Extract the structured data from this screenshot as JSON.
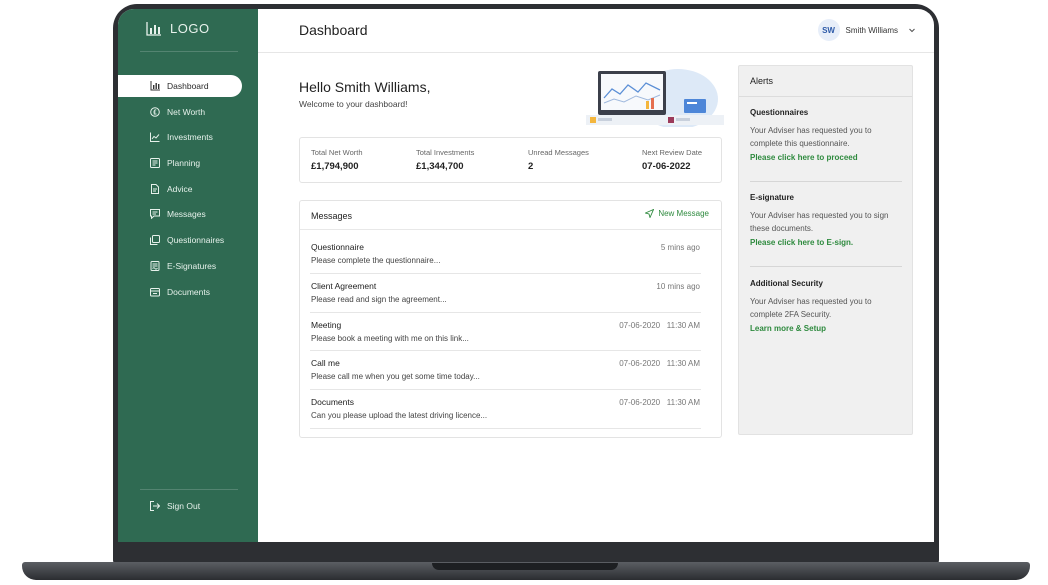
{
  "sidebar": {
    "logo_text": "LOGO",
    "items": [
      {
        "label": "Dashboard",
        "icon": "bar-chart-icon"
      },
      {
        "label": "Net Worth",
        "icon": "pound-coin-icon"
      },
      {
        "label": "Investments",
        "icon": "trend-chart-icon"
      },
      {
        "label": "Planning",
        "icon": "planning-icon"
      },
      {
        "label": "Advice",
        "icon": "document-icon"
      },
      {
        "label": "Messages",
        "icon": "message-icon"
      },
      {
        "label": "Questionnaires",
        "icon": "questionnaire-icon"
      },
      {
        "label": "E-Signatures",
        "icon": "signature-icon"
      },
      {
        "label": "Documents",
        "icon": "folder-icon"
      }
    ],
    "active_item": "Dashboard",
    "sign_out": "Sign Out"
  },
  "header": {
    "title": "Dashboard",
    "user_initials": "SW",
    "user_name": "Smith Williams"
  },
  "greeting": {
    "hello": "Hello Smith Williams,",
    "welcome": "Welcome to your dashboard!"
  },
  "stats": [
    {
      "label": "Total Net Worth",
      "value": "£1,794,900"
    },
    {
      "label": "Total Investments",
      "value": "£1,344,700"
    },
    {
      "label": "Unread Messages",
      "value": "2"
    },
    {
      "label": "Next Review Date",
      "value": "07-06-2022"
    }
  ],
  "messages": {
    "title": "Messages",
    "new_message": "New Message",
    "items": [
      {
        "subject": "Questionnaire",
        "preview": "Please complete the questionnaire...",
        "time": "5 mins ago"
      },
      {
        "subject": "Client Agreement",
        "preview": "Please read and sign the agreement...",
        "time": "10 mins ago"
      },
      {
        "subject": "Meeting",
        "preview": "Please book a meeting with me on this link...",
        "time": "07-06-2020   11:30 AM"
      },
      {
        "subject": "Call me",
        "preview": "Please call me when you get some time today...",
        "time": "07-06-2020   11:30 AM"
      },
      {
        "subject": "Documents",
        "preview": "Can you please upload the latest driving licence...",
        "time": "07-06-2020   11:30 AM"
      }
    ]
  },
  "alerts": {
    "title": "Alerts",
    "items": [
      {
        "title": "Questionnaires",
        "body": "Your Adviser has requested you to complete this questionnaire.",
        "link": "Please click here to proceed"
      },
      {
        "title": "E-signature",
        "body": "Your Adviser has requested you to sign these documents.",
        "link": "Please click here to E-sign."
      },
      {
        "title": "Additional Security",
        "body": "Your Adviser has requested you to complete 2FA Security.",
        "link": "Learn more & Setup"
      }
    ]
  },
  "colors": {
    "sidebar": "#2f6a52",
    "accent_green": "#2e8a3e",
    "avatar_bg": "#e7eef9",
    "laptop_frame": "#2d2f33"
  }
}
